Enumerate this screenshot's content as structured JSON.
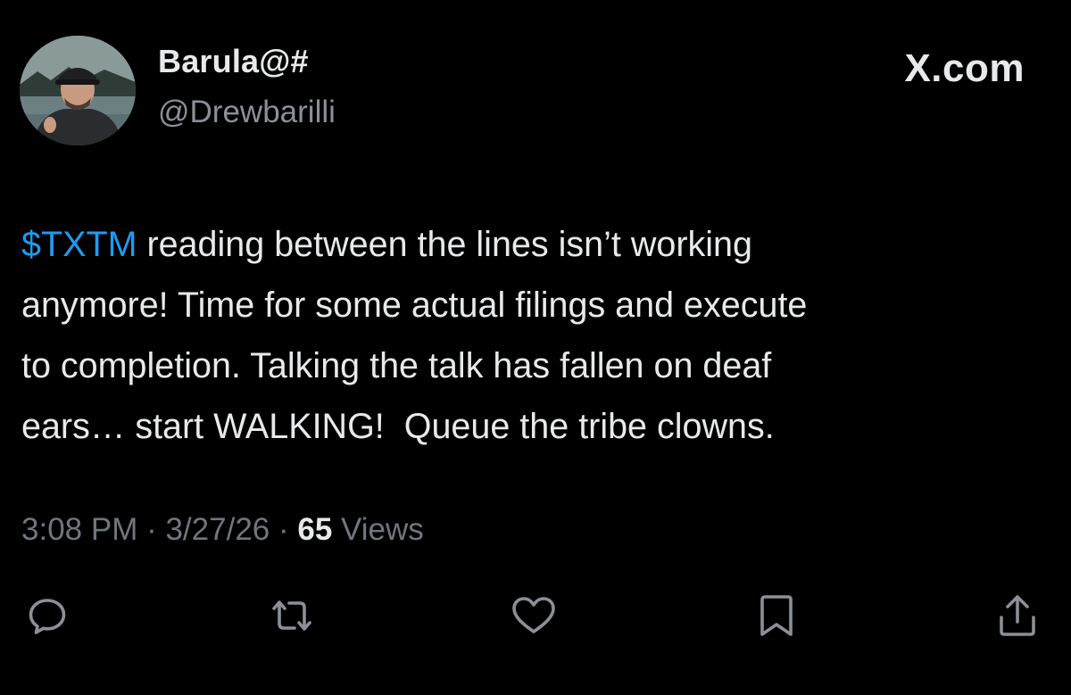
{
  "author": {
    "display_name": "Barula@#",
    "handle": "@Drewbarilli",
    "avatar_icon": "avatar-photo"
  },
  "brand": {
    "label": "X.com"
  },
  "tweet": {
    "cashtag": "$TXTM",
    "text": " reading between the lines isn’t working\nanymore! Time for some actual filings and execute\nto completion. Talking the talk has fallen on deaf\nears… start WALKING!  Queue the tribe clowns."
  },
  "meta": {
    "time": "3:08 PM",
    "separator1": " · ",
    "date": "3/27/26",
    "separator2": " · ",
    "views_count": "65",
    "views_label": " Views"
  },
  "actions": {
    "reply_icon": "reply-icon",
    "repost_icon": "repost-icon",
    "like_icon": "heart-icon",
    "bookmark_icon": "bookmark-icon",
    "share_icon": "share-icon"
  },
  "colors": {
    "background": "#000000",
    "text": "#e7e9ea",
    "secondary": "#8b9096",
    "link": "#1d9bf0"
  }
}
